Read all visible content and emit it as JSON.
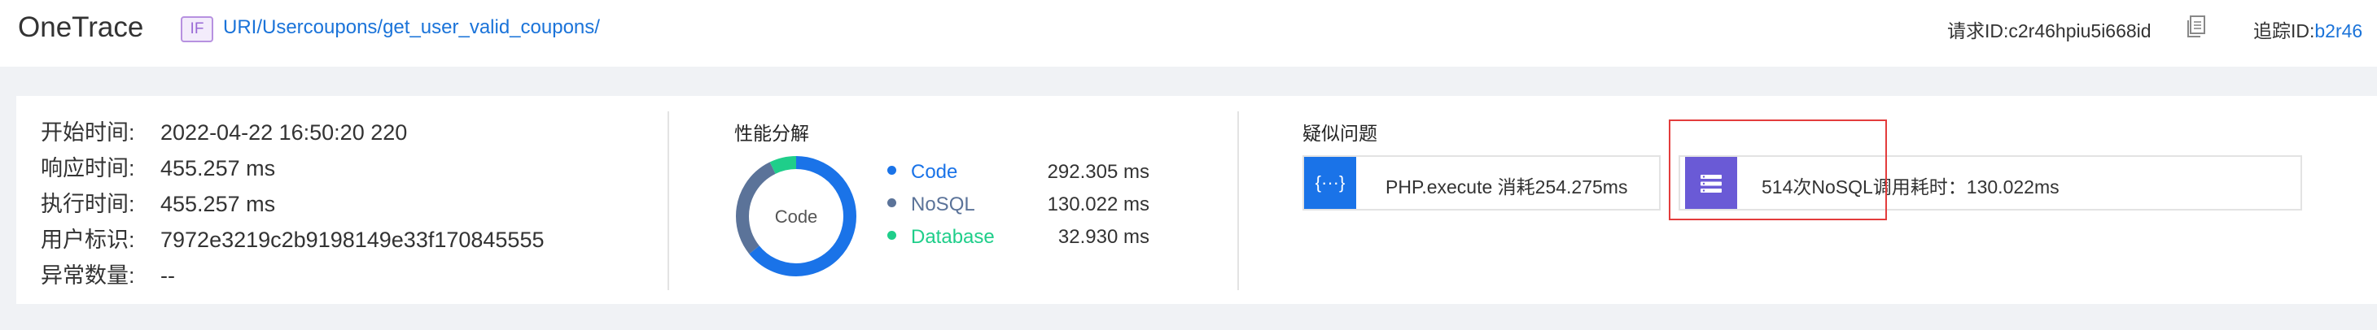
{
  "header": {
    "brand": "OneTrace",
    "badge": "IF",
    "uri": "URI/Usercoupons/get_user_valid_coupons/",
    "request_id_label": "请求ID:",
    "request_id": "c2r46hpiu5i668id",
    "trace_id_label": "追踪ID:",
    "trace_id": "b2r46"
  },
  "summary": {
    "rows": [
      {
        "key": "开始时间:",
        "value": "2022-04-22 16:50:20 220"
      },
      {
        "key": "响应时间:",
        "value": "455.257 ms"
      },
      {
        "key": "执行时间:",
        "value": "455.257 ms"
      },
      {
        "key": "用户标识:",
        "value": "7972e3219c2b9198149e33f170845555"
      },
      {
        "key": "异常数量:",
        "value": "--"
      }
    ]
  },
  "performance": {
    "title": "性能分解",
    "center_label": "Code",
    "items": [
      {
        "name": "Code",
        "value": "292.305 ms",
        "ms": 292.305,
        "color": "#1a73e8"
      },
      {
        "name": "NoSQL",
        "value": "130.022 ms",
        "ms": 130.022,
        "color": "#5b7399"
      },
      {
        "name": "Database",
        "value": "32.930 ms",
        "ms": 32.93,
        "color": "#1fce8a"
      }
    ]
  },
  "issues": {
    "title": "疑似问题",
    "cards": [
      {
        "icon": "braces-icon",
        "text": "PHP.execute  消耗254.275ms",
        "color": "#1a73e8"
      },
      {
        "icon": "list-icon",
        "text": "514次NoSQL调用耗时：130.022ms",
        "color": "#6a5ad6"
      }
    ]
  },
  "colors": {
    "link": "#1a73d9",
    "highlight": "#e33c3c"
  }
}
